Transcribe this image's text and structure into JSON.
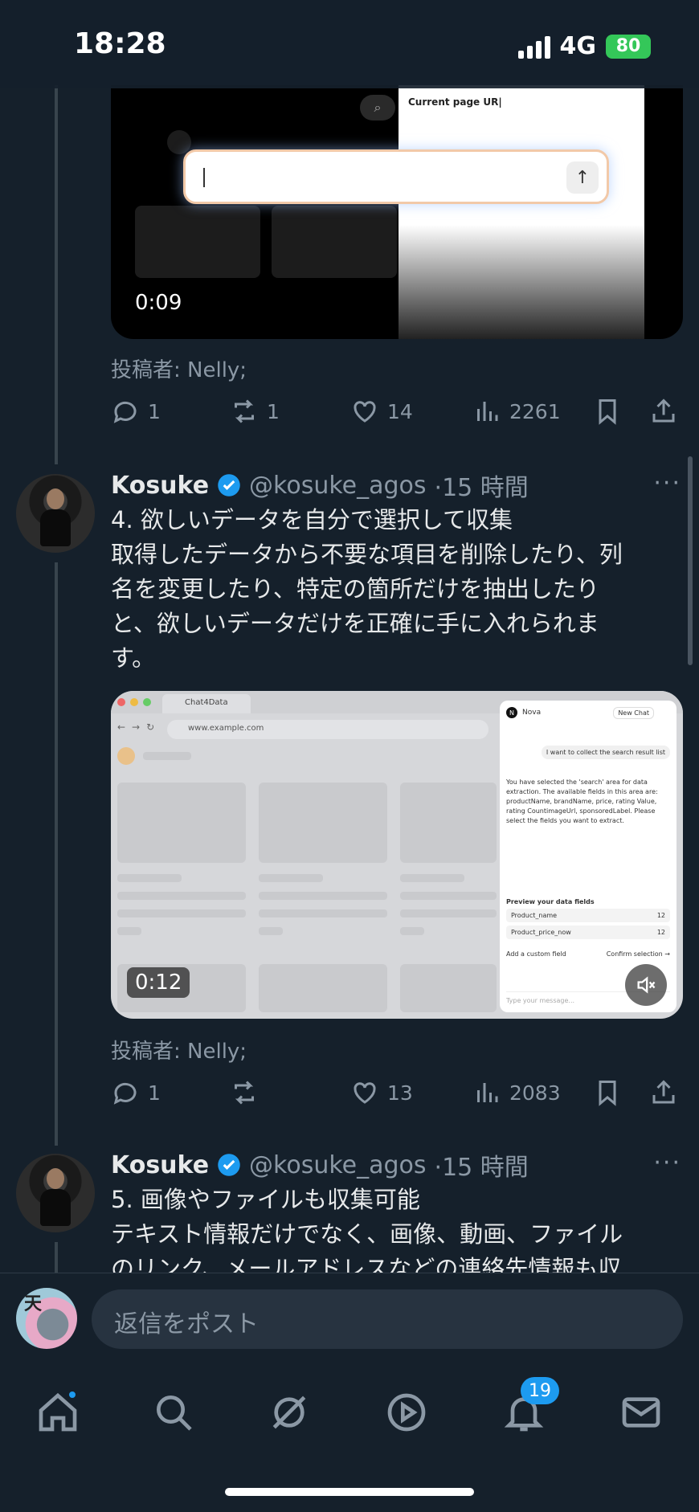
{
  "status_bar": {
    "time": "18:28",
    "network": "4G",
    "battery": "80"
  },
  "tweet1": {
    "video_ui_label": "Current page UR|",
    "video_time": "0:09",
    "posted_by": "投稿者: Nelly;",
    "replies": "1",
    "retweets": "1",
    "likes": "14",
    "views": "2261"
  },
  "tweet2": {
    "name": "Kosuke",
    "handle": "@kosuke_agos",
    "time": "·15 時間",
    "text_lines": [
      "4. 欲しいデータを自分で選択して収集",
      "取得したデータから不要な項目を削除したり、列",
      "名を変更したり、特定の箇所だけを抽出したり",
      "と、欲しいデータだけを正確に手に入れられま",
      "す。"
    ],
    "video": {
      "tab_title": "Chat4Data",
      "url": "www.example.com",
      "panel_brand": "Nova",
      "new_chat": "New Chat",
      "user_msg": "I want to collect the search result list",
      "bot_msg": "You have selected the 'search' area for data extraction. The available fields in this area are: productName, brandName, price, rating Value, rating CountimageUrl, sponsoredLabel. Please select the fields you want to extract.",
      "preview_title": "Preview your data fields",
      "fields": [
        "Product_name",
        "Product_price_now"
      ],
      "field_count": "12",
      "add_field": "Add a custom field",
      "confirm": "Confirm selection →",
      "typing_placeholder": "Type your message..."
    },
    "video_time": "0:12",
    "posted_by": "投稿者: Nelly;",
    "replies": "1",
    "retweets": "",
    "likes": "13",
    "views": "2083"
  },
  "tweet3": {
    "name": "Kosuke",
    "handle": "@kosuke_agos",
    "time": "·15 時間",
    "text_lines": [
      "5. 画像やファイルも収集可能",
      "テキスト情報だけでなく、画像、動画、ファイル",
      "のリンク、メールアドレスなどの連絡先情報も収"
    ]
  },
  "reply_bar": {
    "placeholder": "返信をポスト"
  },
  "bottom_nav": {
    "notifications_count": "19"
  },
  "colors": {
    "background": "#15202b",
    "accent": "#1d9bf0",
    "muted": "#8b98a5"
  }
}
